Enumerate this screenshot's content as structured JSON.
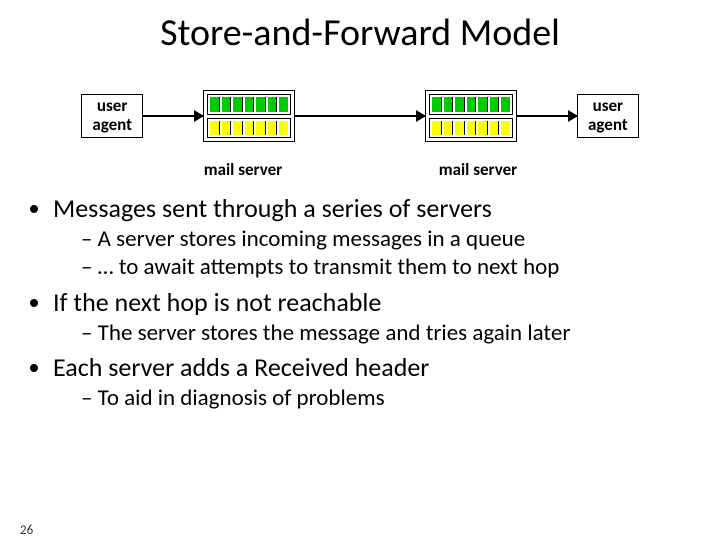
{
  "title": "Store-and-Forward Model",
  "diagram": {
    "agent_left": "user\nagent",
    "agent_right": "user\nagent",
    "server1_label": "mail server",
    "server2_label": "mail server"
  },
  "bullets": {
    "b1": "Messages sent through a series of servers",
    "b1_sub1": "A server stores incoming messages in a queue",
    "b1_sub2": "… to await attempts to transmit them to next hop",
    "b2": "If the next hop is not reachable",
    "b2_sub1": "The server stores the message and tries again later",
    "b3": "Each server adds a Received header",
    "b3_sub1": "To aid in diagnosis of problems"
  },
  "page_number": "26"
}
